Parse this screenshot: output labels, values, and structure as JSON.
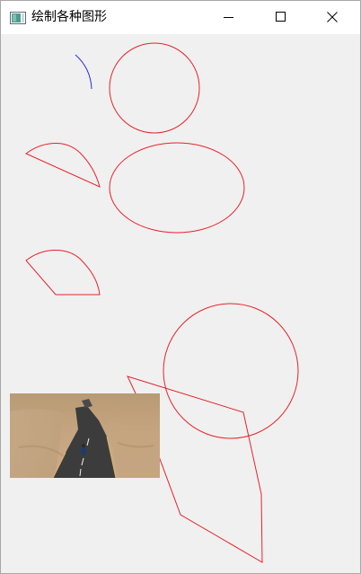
{
  "window": {
    "title": "绘制各种图形",
    "icons": {
      "app": "app-window-icon",
      "minimize": "minimize-icon",
      "maximize": "maximize-icon",
      "close": "close-icon"
    }
  },
  "canvas": {
    "stroke_red": "#e8222a",
    "stroke_blue": "#2a2ae8",
    "background": "#f0f0f0",
    "shapes": [
      "arc",
      "circle",
      "pie",
      "ellipse",
      "pie",
      "circle",
      "polygon",
      "image"
    ]
  },
  "image": {
    "subject": "desert-road-photo"
  }
}
